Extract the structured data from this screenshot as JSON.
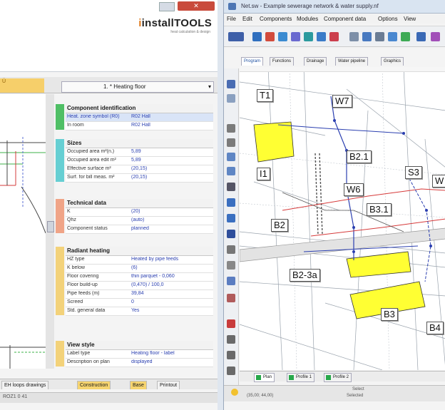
{
  "left_window": {
    "logo": "installTOOLS",
    "logo_sub": "heat calculation & design",
    "top_tab": "Ü",
    "floor_select": "1. * Heating floor",
    "sections": [
      {
        "title": "Component identification",
        "color": "#4fbf65",
        "rows": [
          {
            "k": "Heat. zone symbol (R0)",
            "v": "R02 Hall",
            "sel": true
          },
          {
            "k": "In room",
            "v": "R02 Hall",
            "sel": false
          }
        ]
      },
      {
        "title": "Sizes",
        "color": "#66cfd3",
        "rows": [
          {
            "k": "Occupied area m²(n.)",
            "v": "5,89"
          },
          {
            "k": "Occupied area edit m²",
            "v": "5,89"
          },
          {
            "k": "Effective surface m²",
            "v": "(20,15)"
          },
          {
            "k": "Surf. for bill meas. m²",
            "v": "(20,15)"
          }
        ]
      },
      {
        "title": "Technical data",
        "color": "#f0a487",
        "rows": [
          {
            "k": "K",
            "v": "(20)"
          },
          {
            "k": "Qhz",
            "v": "(auto)"
          },
          {
            "k": "Component status",
            "v": "planned"
          }
        ]
      },
      {
        "title": "Radiant heating",
        "color": "#f3d27a",
        "rows": [
          {
            "k": "HZ type",
            "v": "Heated by pipe feeds"
          },
          {
            "k": "K below",
            "v": "(6)"
          },
          {
            "k": "Floor covering",
            "v": "thin parquet - 0,060"
          },
          {
            "k": "Floor build-up",
            "v": "(0,470) / 100,0"
          },
          {
            "k": "Pipe feeds (m)",
            "v": "39,84"
          },
          {
            "k": "Screed",
            "v": "0"
          },
          {
            "k": "Std. general data",
            "v": "Yes"
          }
        ]
      },
      {
        "title": "View style",
        "color": "#f3d27a",
        "rows": [
          {
            "k": "Label type",
            "v": "Heating floor - label"
          },
          {
            "k": "Description on plan",
            "v": "displayed"
          }
        ]
      }
    ],
    "bottom_tabs": [
      "EH loops drawings",
      "Construction",
      "Base",
      "Printout"
    ],
    "status": "ROZ1  0  41"
  },
  "right_window": {
    "title": "Net.sw - Example sewerage network & water supply.nf",
    "menu": [
      "File",
      "Edit",
      "Components",
      "Modules",
      "Component data",
      "Options",
      "View"
    ],
    "sheet_tabs": [
      "Program",
      "Functions",
      "Drainage",
      "Water pipeline",
      "Graphics"
    ],
    "node_labels": [
      {
        "text": "T1",
        "sub": ""
      },
      {
        "text": "W7",
        "sub": ""
      },
      {
        "text": "B2.1",
        "sub": ""
      },
      {
        "text": "S3",
        "sub": ""
      },
      {
        "text": "W6",
        "sub": ""
      },
      {
        "text": "B3.1",
        "sub": ""
      },
      {
        "text": "B2",
        "sub": ""
      },
      {
        "text": "B2-3a",
        "sub": ""
      },
      {
        "text": "B3",
        "sub": ""
      },
      {
        "text": "B4",
        "sub": ""
      },
      {
        "text": "I1",
        "sub": ""
      },
      {
        "text": "W",
        "sub": ""
      }
    ],
    "bottom_tabs": [
      "Plan",
      "Profile 1",
      "Profile 2"
    ],
    "status_coords": "(35,00; 44,00)",
    "status_center": "Select",
    "status_center2": "Selected"
  }
}
